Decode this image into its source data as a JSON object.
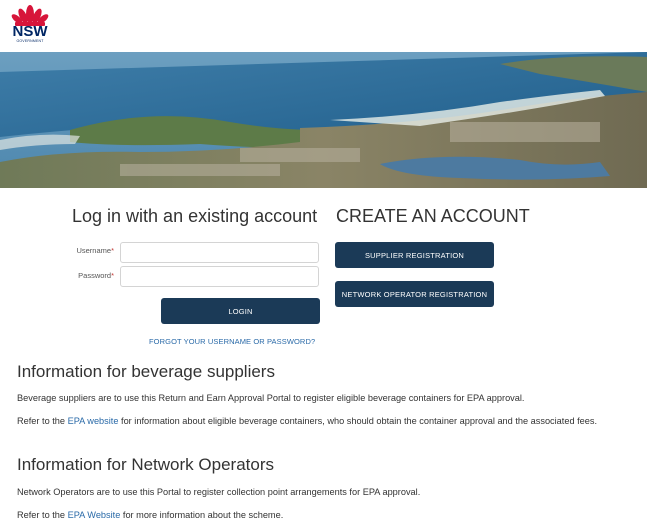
{
  "header": {
    "logo_text": "NSW",
    "logo_subtext": "GOVERNMENT",
    "logo_icon": "waratah-flower-icon"
  },
  "banner": {
    "image": "coastal-aerial-photo",
    "colors": {
      "sky": "#5a93b8",
      "sea": "#2d6b97",
      "land": "#7d8a60"
    }
  },
  "login": {
    "heading": "Log in with an existing account",
    "username_label": "Username",
    "password_label": "Password",
    "required_marker": "*",
    "username_value": "",
    "password_value": "",
    "login_button": "LOGIN",
    "forgot_link": "FORGOT YOUR USERNAME OR PASSWORD?"
  },
  "create": {
    "heading": "CREATE AN ACCOUNT",
    "supplier_button": "SUPPLIER REGISTRATION",
    "network_button": "NETWORK OPERATOR REGISTRATION"
  },
  "suppliers": {
    "heading": "Information for beverage suppliers",
    "paragraph1": "Beverage suppliers are to use this Return and Earn Approval Portal to register eligible beverage containers for EPA approval.",
    "paragraph2_prefix": "Refer to the ",
    "paragraph2_link": "EPA website",
    "paragraph2_suffix": " for information about eligible beverage containers, who should obtain the container approval and the associated fees."
  },
  "operators": {
    "heading": "Information for Network Operators",
    "paragraph1": "Network Operators are to use this Portal to register collection point arrangements for EPA approval.",
    "paragraph2_prefix": "Refer to the ",
    "paragraph2_link": "EPA Website",
    "paragraph2_suffix": " for more information about the scheme."
  },
  "colors": {
    "button": "#1b3a57",
    "link": "#2a6aa8",
    "logo_red": "#d7153a",
    "logo_blue": "#002664"
  }
}
